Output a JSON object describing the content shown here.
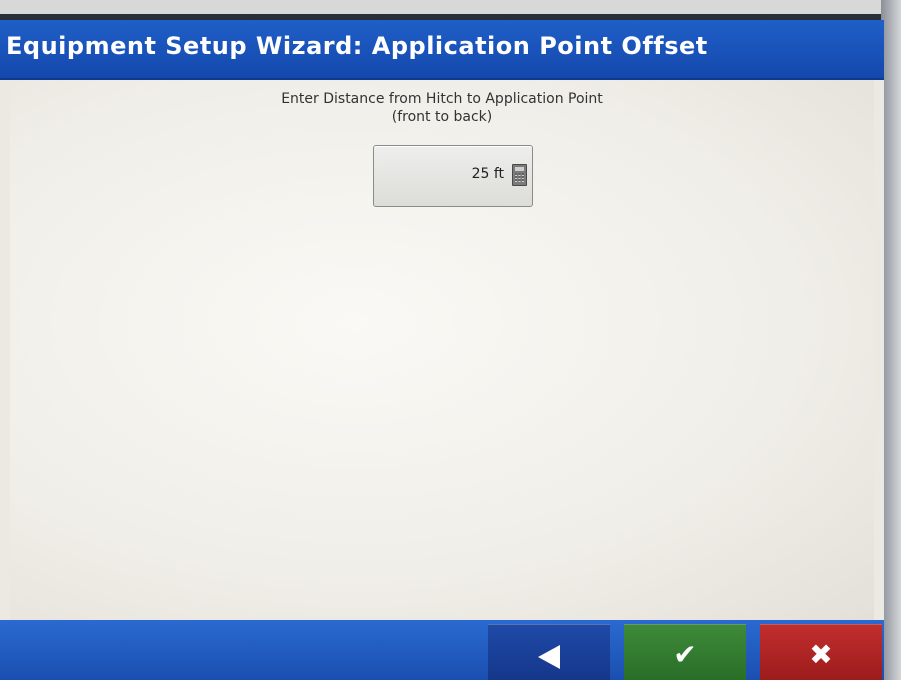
{
  "window": {
    "title": "Equipment Setup Wizard:  Application Point Offset"
  },
  "main": {
    "prompt_line1": "Enter Distance from Hitch to Application Point",
    "prompt_line2": "(front to back)",
    "distance_field": {
      "value": "25 ft",
      "icon": "calculator-icon"
    }
  },
  "footer": {
    "back_icon": "back-arrow-icon",
    "ok_icon": "checkmark-icon",
    "cancel_icon": "close-icon"
  },
  "colors": {
    "title_bar": "#1a52bb",
    "back_button": "#1a40a0",
    "ok_button": "#347c31",
    "cancel_button": "#b02525"
  }
}
